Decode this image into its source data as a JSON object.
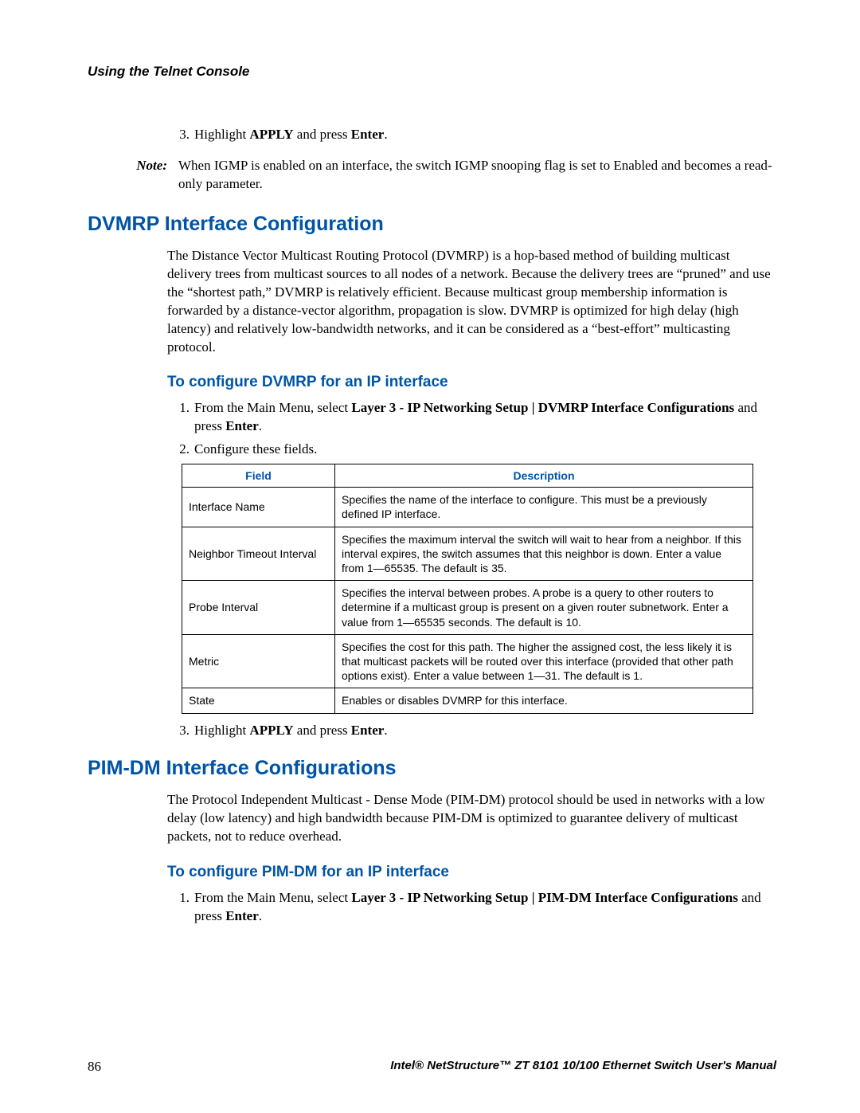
{
  "running_head": "Using the Telnet Console",
  "pre_steps": {
    "s3_num": "3.",
    "s3_a": "Highlight ",
    "s3_b": "APPLY",
    "s3_c": " and press ",
    "s3_d": "Enter",
    "s3_e": "."
  },
  "note": {
    "label": "Note:",
    "text": "When IGMP is enabled on an interface, the switch IGMP snooping flag is set to Enabled and becomes a read-only parameter."
  },
  "dvmrp": {
    "title": "DVMRP Interface Configuration",
    "para": "The Distance Vector Multicast Routing Protocol (DVMRP) is a hop-based method of building multicast delivery trees from multicast sources to all nodes of a network. Because the delivery trees are “pruned” and use the “shortest path,” DVMRP is relatively efficient. Because multicast group membership information is forwarded by a distance-vector algorithm, propagation is slow. DVMRP is optimized for high delay (high latency) and relatively low-bandwidth networks, and it can be considered as a “best-effort” multicasting protocol.",
    "sub": "To configure DVMRP for an IP interface",
    "s1_num": "1.",
    "s1_a": "From the Main Menu, select ",
    "s1_b": "Layer 3 - IP Networking Setup | DVMRP Interface Configurations",
    "s1_c": " and press ",
    "s1_d": "Enter",
    "s1_e": ".",
    "s2_num": "2.",
    "s2_text": "Configure these fields."
  },
  "table": {
    "h_field": "Field",
    "h_desc": "Description",
    "rows": [
      {
        "field": "Interface Name",
        "desc": "Specifies the name of the interface to configure. This must be a previously defined IP interface."
      },
      {
        "field": "Neighbor Timeout Interval",
        "desc": "Specifies the maximum interval the switch will wait to hear from a neighbor. If this interval expires, the switch assumes that this neighbor is down. Enter a value from 1—65535. The default is 35."
      },
      {
        "field": "Probe Interval",
        "desc": "Specifies the interval between probes. A probe is a query to other routers to determine if a multicast group is present on a given router subnetwork. Enter a value from 1—65535 seconds. The default is 10."
      },
      {
        "field": "Metric",
        "desc": "Specifies the cost for this path. The higher the assigned cost, the less likely it is that multicast packets will be routed over this interface (provided that other path options exist).  Enter a value between 1—31. The default is 1."
      },
      {
        "field": "State",
        "desc": "Enables or disables DVMRP for this interface."
      }
    ]
  },
  "dvmrp_post": {
    "s3_num": "3.",
    "s3_a": "Highlight ",
    "s3_b": "APPLY",
    "s3_c": " and press ",
    "s3_d": "Enter",
    "s3_e": "."
  },
  "pim": {
    "title": "PIM-DM Interface Configurations",
    "para": "The Protocol Independent Multicast - Dense Mode (PIM-DM) protocol should be used in networks with a low delay (low latency) and high bandwidth because PIM-DM is optimized to guarantee delivery of multicast packets, not to reduce overhead.",
    "sub": "To configure PIM-DM for an IP interface",
    "s1_num": "1.",
    "s1_a": "From the Main Menu, select ",
    "s1_b": "Layer 3 - IP Networking Setup | PIM-DM Interface Configurations",
    "s1_c": " and press ",
    "s1_d": "Enter",
    "s1_e": "."
  },
  "footer": {
    "page": "86",
    "title": "Intel® NetStructure™  ZT 8101 10/100 Ethernet Switch User's Manual"
  }
}
